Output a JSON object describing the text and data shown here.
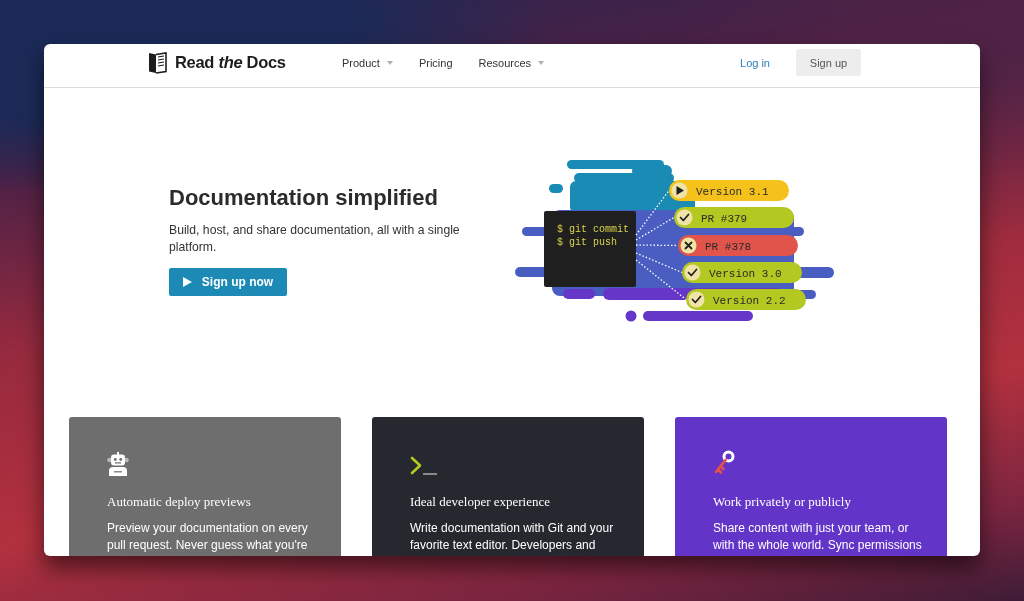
{
  "header": {
    "logo": "Read *the* Docs",
    "nav": [
      {
        "label": "Product",
        "dropdown": true
      },
      {
        "label": "Pricing",
        "dropdown": false
      },
      {
        "label": "Resources",
        "dropdown": true
      }
    ],
    "login": "Log in",
    "signup": "Sign up"
  },
  "hero": {
    "title": "Documentation simplified",
    "subtitle": "Build, host, and share documentation, all with a single platform.",
    "cta": "Sign up now",
    "illustration": {
      "terminal_lines": [
        "$ git commit",
        "$ git push"
      ],
      "builds": [
        {
          "label": "Version 3.1",
          "kind": "running",
          "color": "#f5c21b"
        },
        {
          "label": "PR #379",
          "kind": "passed",
          "color": "#b3c820"
        },
        {
          "label": "PR #378",
          "kind": "failed",
          "color": "#e0544b"
        },
        {
          "label": "Version 3.0",
          "kind": "passed",
          "color": "#b3c820"
        },
        {
          "label": "Version 2.2",
          "kind": "passed",
          "color": "#b3c820"
        }
      ]
    }
  },
  "features": [
    {
      "title": "Automatic deploy previews",
      "text": "Preview your documentation on every pull request. Never guess what you're",
      "color": "#6e6e6e"
    },
    {
      "title": "Ideal developer experience",
      "text": "Write documentation with Git and your favorite text editor. Developers and",
      "color": "#25292f"
    },
    {
      "title": "Work privately or publicly",
      "text": "Share content with just your team, or with the whole world. Sync permissions",
      "color": "#6334c8"
    }
  ]
}
